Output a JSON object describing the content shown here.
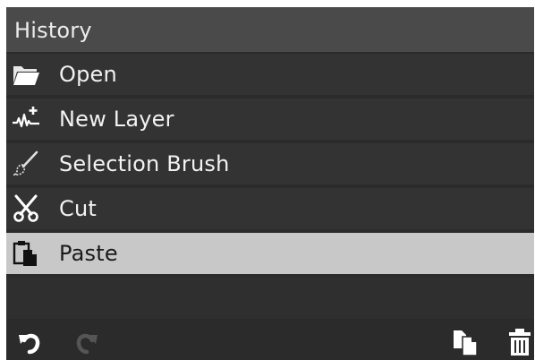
{
  "panel": {
    "title": "History"
  },
  "history": {
    "items": [
      {
        "label": "Open",
        "icon": "folder-icon",
        "selected": false
      },
      {
        "label": "New Layer",
        "icon": "new-layer-icon",
        "selected": false
      },
      {
        "label": "Selection Brush",
        "icon": "brush-icon",
        "selected": false
      },
      {
        "label": "Cut",
        "icon": "scissors-icon",
        "selected": false
      },
      {
        "label": "Paste",
        "icon": "paste-icon",
        "selected": true
      }
    ]
  },
  "footer": {
    "undo_icon": "undo-icon",
    "redo_icon": "redo-icon",
    "duplicate_icon": "duplicate-icon",
    "delete_icon": "trash-icon",
    "redo_enabled": false
  },
  "colors": {
    "panel_bg": "#2b2b2b",
    "title_bg": "#4a4a4a",
    "row_bg": "#333333",
    "selected_bg": "#c8c8c8",
    "text": "#f2f2f2",
    "selected_text": "#1a1a1a",
    "disabled_icon": "#555555"
  }
}
